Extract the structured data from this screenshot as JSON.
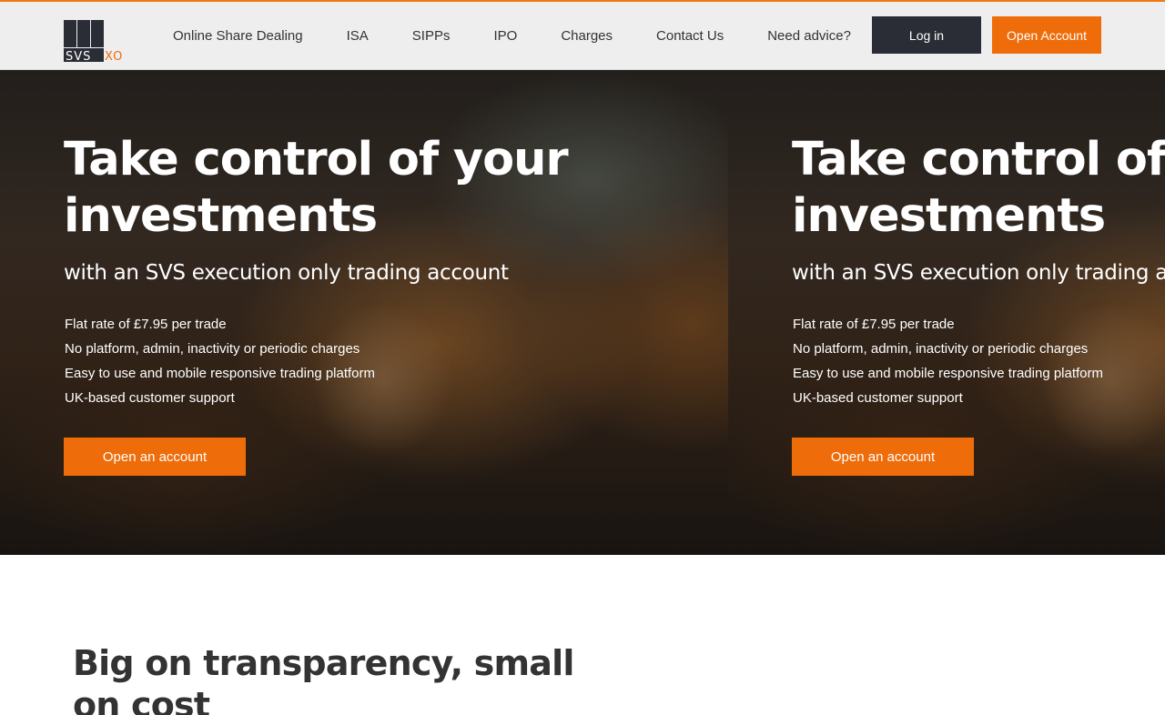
{
  "brand": {
    "logo_text": "SVSXO",
    "accent_color": "#ef6c0a",
    "dark_color": "#2a2d35"
  },
  "nav": {
    "items": [
      {
        "label": "Online Share Dealing"
      },
      {
        "label": "ISA"
      },
      {
        "label": "SIPPs"
      },
      {
        "label": "IPO"
      },
      {
        "label": "Charges"
      },
      {
        "label": "Contact Us"
      },
      {
        "label": "Need advice?"
      }
    ],
    "login_label": "Log in",
    "open_account_label": "Open Account"
  },
  "hero": {
    "slides": [
      {
        "title": "Take control of your investments",
        "subtitle": "with an SVS execution only trading account",
        "bullets": [
          "Flat rate of £7.95 per trade",
          "No platform, admin, inactivity or periodic charges",
          "Easy to use and mobile responsive trading platform",
          "UK-based customer support"
        ],
        "cta_label": "Open an account"
      },
      {
        "title": "Take control of your investments",
        "subtitle": "with an SVS execution only trading account",
        "bullets": [
          "Flat rate of £7.95 per trade",
          "No platform, admin, inactivity or periodic charges",
          "Easy to use and mobile responsive trading platform",
          "UK-based customer support"
        ],
        "cta_label": "Open an account"
      }
    ]
  },
  "section": {
    "title": "Big on transparency, small on cost"
  }
}
